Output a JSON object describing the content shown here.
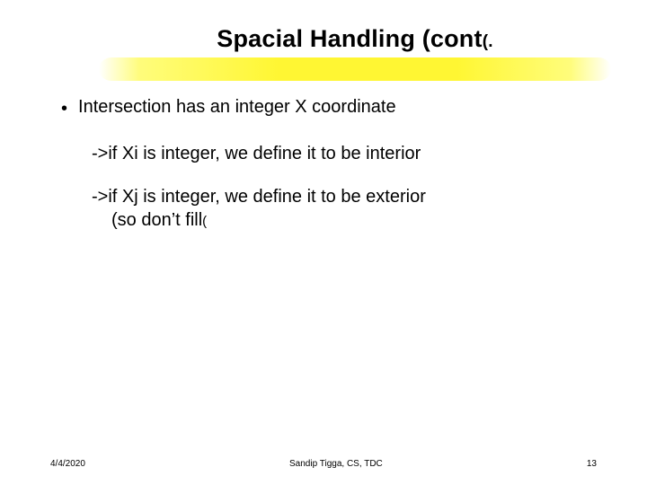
{
  "slide": {
    "title_main": "Spacial Handling (cont",
    "title_tail": "(.",
    "bullet1": "Intersection has an integer X coordinate",
    "sub1": "->if Xi is integer, we define it to be interior",
    "sub2_line1": "->if Xj is integer, we define it to be exterior",
    "sub2_line2_pre": "(so don",
    "sub2_line2_apos": "’",
    "sub2_line2_post": "t fill",
    "sub2_line2_tail": "("
  },
  "footer": {
    "date": "4/4/2020",
    "author": "Sandip Tigga, CS, TDC",
    "page": "13"
  }
}
